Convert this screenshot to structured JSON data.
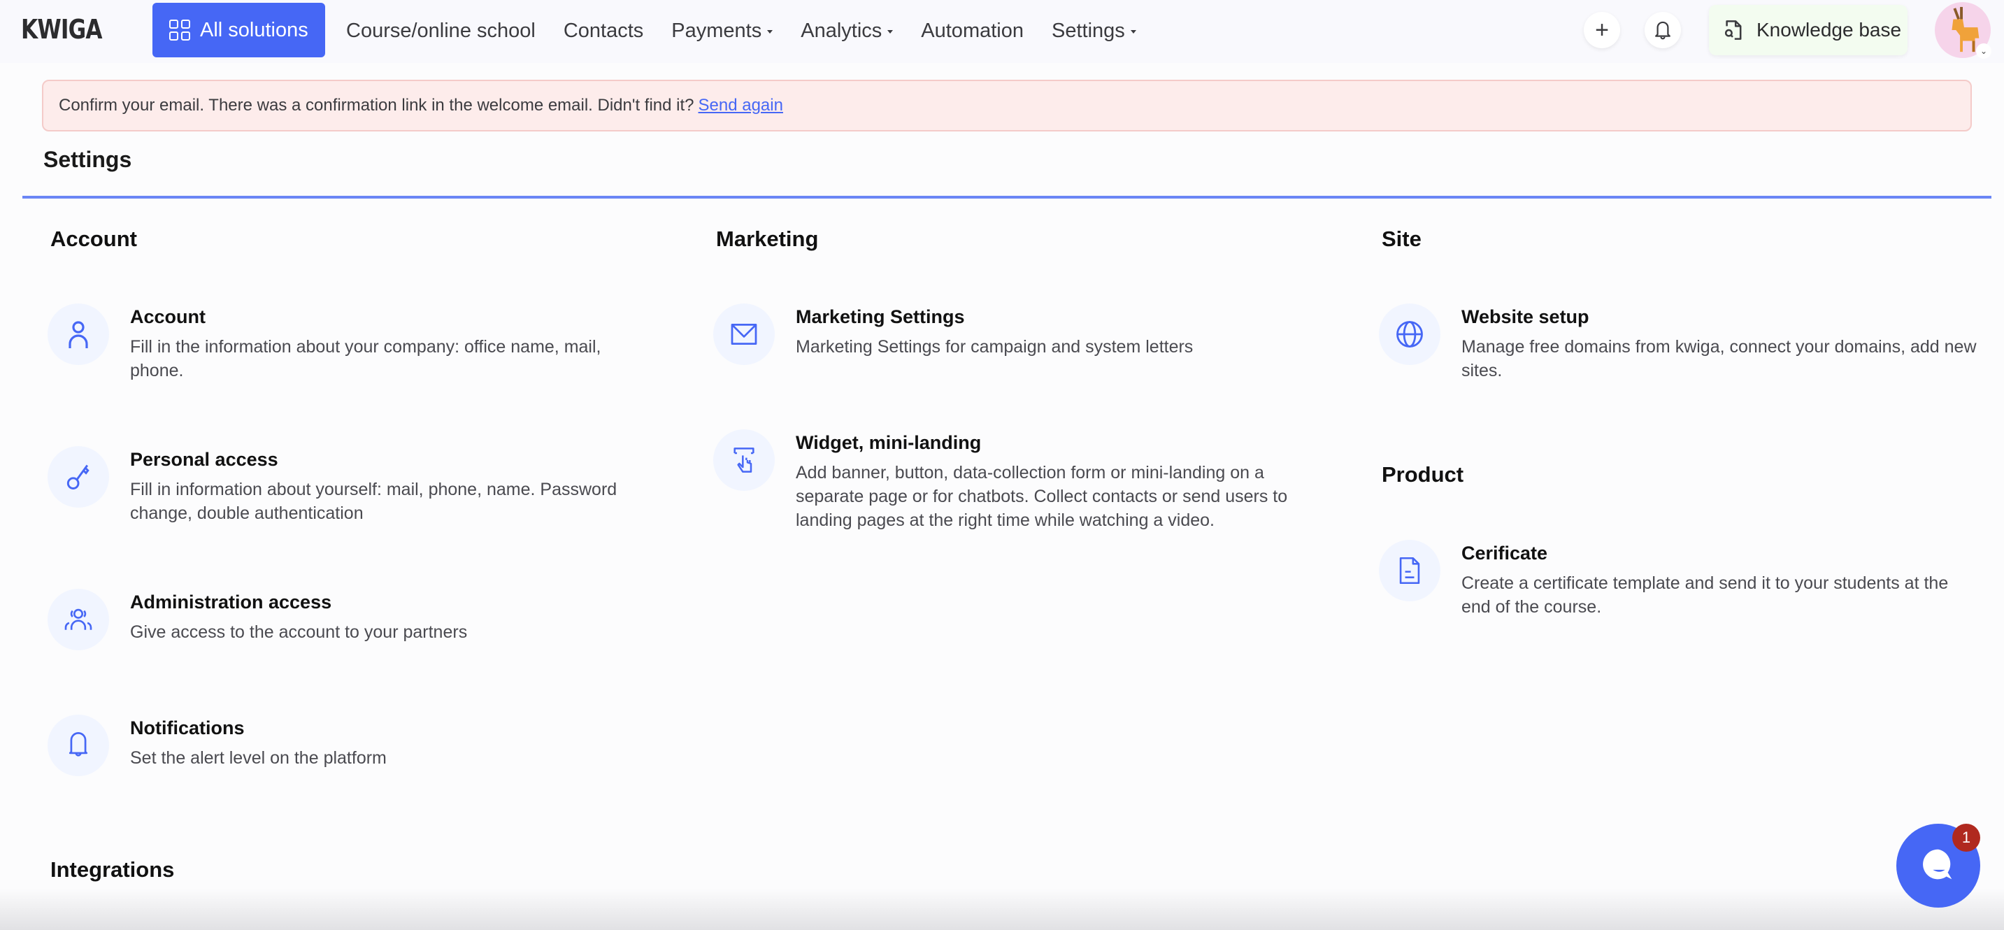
{
  "nav": {
    "logo": "KWIGA",
    "all_solutions": "All solutions",
    "items": [
      {
        "label": "Course/online school",
        "has_dropdown": false
      },
      {
        "label": "Contacts",
        "has_dropdown": false
      },
      {
        "label": "Payments",
        "has_dropdown": true
      },
      {
        "label": "Analytics",
        "has_dropdown": true
      },
      {
        "label": "Automation",
        "has_dropdown": false
      },
      {
        "label": "Settings",
        "has_dropdown": true
      }
    ],
    "plus_icon": "+",
    "knowledge_base": "Knowledge base",
    "avatar_chevron": "⌄"
  },
  "banner": {
    "message": "Confirm your email. There was a confirmation link in the welcome email. Didn't find it?",
    "link": "Send again"
  },
  "page": {
    "title": "Settings"
  },
  "sections": {
    "account": {
      "heading": "Account",
      "items": [
        {
          "title": "Account",
          "desc": "Fill in the information about your company: office name, mail, phone.",
          "icon": "user-icon"
        },
        {
          "title": "Personal access",
          "desc": "Fill in information about yourself: mail, phone, name. Password change, double authentication",
          "icon": "key-icon"
        },
        {
          "title": "Administration access",
          "desc": "Give access to the account to your partners",
          "icon": "users-icon"
        },
        {
          "title": "Notifications",
          "desc": "Set the alert level on the platform",
          "icon": "bell-icon"
        }
      ]
    },
    "marketing": {
      "heading": "Marketing",
      "items": [
        {
          "title": "Marketing Settings",
          "desc": "Marketing Settings for campaign and system letters",
          "icon": "envelope-icon"
        },
        {
          "title": "Widget, mini-landing",
          "desc": "Add banner, button, data-collection form or mini-landing on a separate page or for chatbots. Collect contacts or send users to landing pages at the right time while watching a video.",
          "icon": "widget-pointer-icon"
        }
      ]
    },
    "site": {
      "heading": "Site",
      "items": [
        {
          "title": "Website setup",
          "desc": "Manage free domains from kwiga, connect your domains, add new sites.",
          "icon": "globe-icon"
        }
      ]
    },
    "product": {
      "heading": "Product",
      "items": [
        {
          "title": "Cerificate",
          "desc": "Create a certificate template and send it to your students at the end of the course.",
          "icon": "document-icon"
        }
      ]
    },
    "integrations": {
      "heading": "Integrations"
    }
  },
  "chat": {
    "badge_count": "1"
  },
  "colors": {
    "accent": "#4667f5",
    "divider": "#6b86f5",
    "banner_bg": "#fdeceb",
    "banner_border": "#f4cbc9",
    "badge": "#b0291f",
    "icon_bg": "#f1f5ff"
  }
}
